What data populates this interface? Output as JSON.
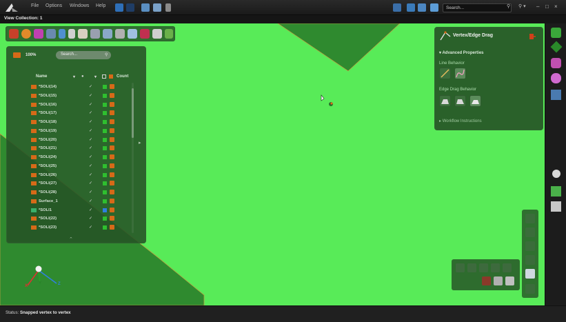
{
  "menu": [
    "File",
    "Options",
    "Windows",
    "Help"
  ],
  "search_top": {
    "placeholder": "Search..."
  },
  "window_controls": [
    "–",
    "□",
    "×"
  ],
  "collection_tab": "View Collection: 1",
  "tree_panel": {
    "zoom": "100%",
    "search_placeholder": "Search...",
    "columns": {
      "name": "Name",
      "count": "Count"
    },
    "rows": [
      {
        "name": "*SOLI(14)",
        "color": "#2fbf2f",
        "icon": "solid-icon"
      },
      {
        "name": "*SOLI(15)",
        "color": "#2fbf2f",
        "icon": "solid-icon"
      },
      {
        "name": "*SOLI(16)",
        "color": "#2fbf2f",
        "icon": "solid-icon"
      },
      {
        "name": "*SOLI(17)",
        "color": "#2fbf2f",
        "icon": "solid-icon"
      },
      {
        "name": "*SOLI(18)",
        "color": "#2fbf2f",
        "icon": "solid-icon"
      },
      {
        "name": "*SOLI(19)",
        "color": "#2fbf2f",
        "icon": "solid-icon"
      },
      {
        "name": "*SOLI(20)",
        "color": "#2fbf2f",
        "icon": "solid-icon"
      },
      {
        "name": "*SOLI(21)",
        "color": "#2fbf2f",
        "icon": "solid-icon"
      },
      {
        "name": "*SOLI(24)",
        "color": "#2fbf2f",
        "icon": "solid-icon"
      },
      {
        "name": "*SOLI(25)",
        "color": "#2fbf2f",
        "icon": "solid-icon"
      },
      {
        "name": "*SOLI(26)",
        "color": "#2fbf2f",
        "icon": "solid-icon"
      },
      {
        "name": "*SOLI(27)",
        "color": "#2fbf2f",
        "icon": "solid-icon"
      },
      {
        "name": "*SOLI(28)",
        "color": "#2fbf2f",
        "icon": "solid-icon"
      },
      {
        "name": "Surface_1",
        "color": "#2fbf2f",
        "icon": "surface-icon"
      },
      {
        "name": "*SOLI1",
        "color": "#2f7fe0",
        "icon": "body-icon"
      },
      {
        "name": "*SOLI(22)",
        "color": "#2fbf2f",
        "icon": "solid-icon"
      },
      {
        "name": "*SOLI(23)",
        "color": "#2fbf2f",
        "icon": "solid-icon"
      }
    ],
    "checkmark": "✓"
  },
  "drag_panel": {
    "title": "Vertex/Edge Drag",
    "advanced": "Advanced Properties",
    "line_behavior": "Line Behavior",
    "edge_behavior": "Edge Drag Behavior",
    "workflow": "Workflow Instructions"
  },
  "axes": {
    "x": "X",
    "y": "Y",
    "z": "Z"
  },
  "status": {
    "label": "Status:",
    "text": "Snapped vertex to vertex"
  },
  "colors": {
    "viewport": "#58eb58",
    "dark_face": "#2d8a2d",
    "accent": "#d66a18"
  }
}
